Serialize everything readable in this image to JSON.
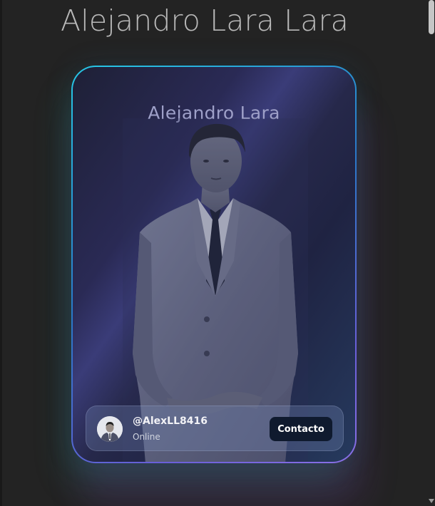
{
  "page": {
    "heading": "Alejandro Lara Lara"
  },
  "card": {
    "title": "Alejandro Lara",
    "profile": {
      "handle": "@AlexLL8416",
      "status": "Online",
      "contact_label": "Contacto"
    }
  },
  "colors": {
    "page_background": "#232323",
    "card_border_start": "#27c8e6",
    "card_border_end": "#8a70e6",
    "button_background": "#0f1a2e"
  },
  "icons": {
    "avatar": "person-photo-icon",
    "scroll_down": "arrow-down-icon"
  }
}
